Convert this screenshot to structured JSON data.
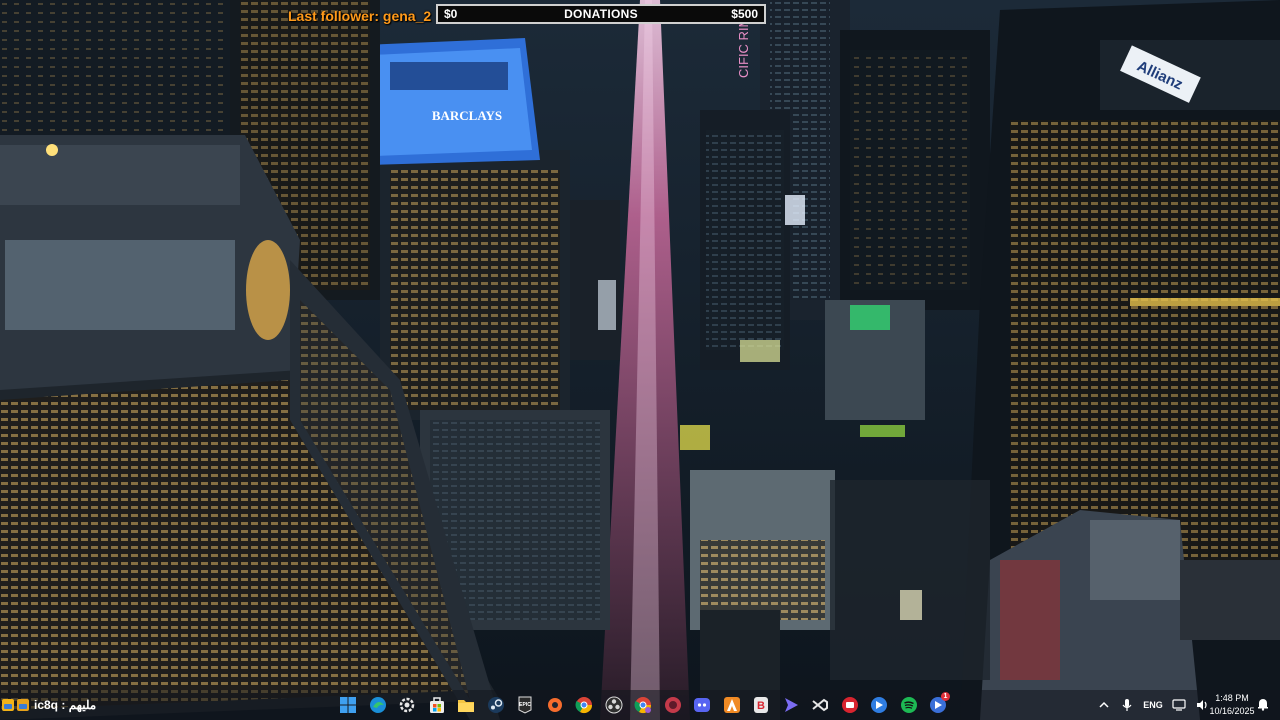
{
  "overlay": {
    "last_follower": "Last follower: gena_2",
    "donations": {
      "min": "$0",
      "title": "DONATIONS",
      "max": "$500",
      "progress": 0.0
    }
  },
  "wallpaper": {
    "signs": [
      "BARCLAYS",
      "Allianz",
      "CIFIC RIM"
    ]
  },
  "taskbar": {
    "widget_text": "ic8q : مليهم",
    "pinned_apps": [
      "start-icon",
      "edge-icon",
      "settings-icon",
      "store-icon",
      "file-explorer-icon",
      "steam-icon",
      "epic-games-icon",
      "origin-icon",
      "chrome-icon",
      "obs-icon",
      "chrome-profile-icon",
      "browser-icon",
      "discord-icon",
      "app-a-icon",
      "app-b-icon",
      "app-arrow-icon",
      "vscode-icon",
      "app-red-icon",
      "app-blue-icon",
      "spotify-icon",
      "app-badge-icon"
    ],
    "notification_badge": "1",
    "tray": {
      "language": "ENG",
      "time": "1:48 PM",
      "date": "10/16/2025"
    }
  },
  "colors": {
    "follower_text": "#ff9a1a",
    "donation_bar_border": "#d0d0d0",
    "donation_fill": "#2aa84a",
    "taskbar_bg": "rgba(18,22,30,0.55)"
  }
}
